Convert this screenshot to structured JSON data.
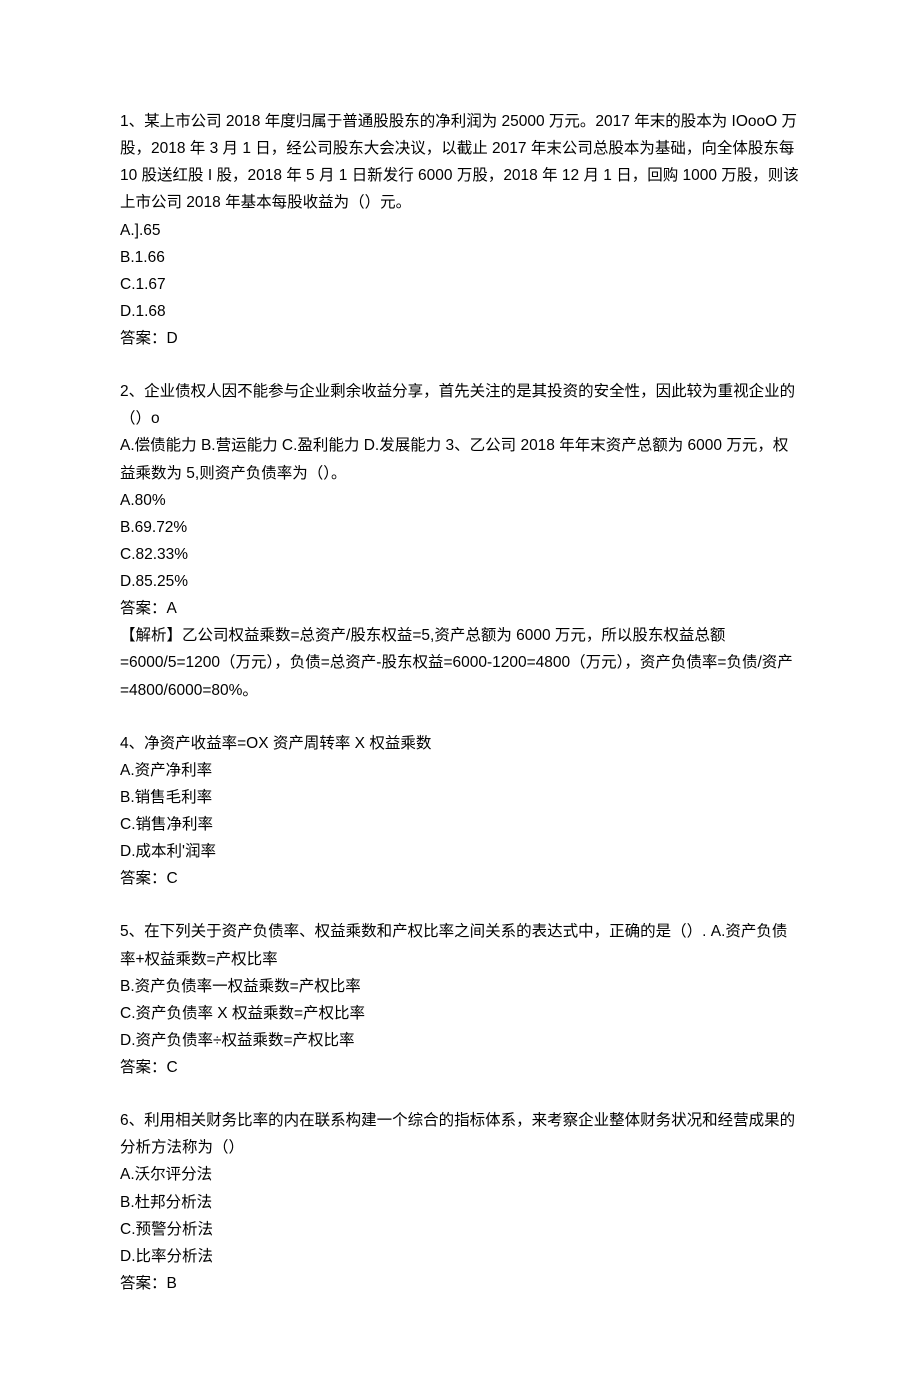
{
  "questions": [
    {
      "stem": [
        "1、某上市公司 2018 年度归属于普通股股东的净利润为 25000 万元。2017 年末的股本为 IOooO 万股，2018 年 3 月 1 日，经公司股东大会决议，以截止 2017 年末公司总股本为基础，向全体股东每 10 股送红股 I 股，2018 年 5 月 1 日新发行 6000 万股，2018 年 12 月 1 日，回购 1000 万股，则该上市公司 2018 年基本每股收益为（）元。"
      ],
      "options": [
        "A.].65",
        "B.1.66",
        "C.1.67",
        "D.1.68"
      ],
      "answer": "答案：D",
      "analysis": []
    },
    {
      "stem": [
        "2、企业债权人因不能参与企业剩余收益分享，首先关注的是其投资的安全性，因此较为重视企业的（）o",
        "A.偿债能力 B.营运能力 C.盈利能力 D.发展能力 3、乙公司 2018 年年末资产总额为 6000 万元，权益乘数为 5,则资产负债率为（）。"
      ],
      "options": [
        "A.80%",
        "B.69.72%",
        "C.82.33%",
        "D.85.25%"
      ],
      "answer": "答案：A",
      "analysis": [
        "【解析】乙公司权益乘数=总资产/股东权益=5,资产总额为 6000 万元，所以股东权益总额=6000/5=1200（万元），负债=总资产-股东权益=6000-1200=4800（万元），资产负债率=负债/资产=4800/6000=80%。"
      ]
    },
    {
      "stem": [
        "4、净资产收益率=OX 资产周转率 X 权益乘数"
      ],
      "options": [
        "A.资产净利率",
        "B.销售毛利率",
        "C.销售净利率",
        "D.成本利'润率"
      ],
      "answer": "答案：C",
      "analysis": []
    },
    {
      "stem": [
        "5、在下列关于资产负债率、权益乘数和产权比率之间关系的表达式中，正确的是（）. A.资产负债率+权益乘数=产权比率"
      ],
      "options": [
        "B.资产负债率一权益乘数=产权比率",
        "C.资产负债率 X 权益乘数=产权比率",
        "D.资产负债率÷权益乘数=产权比率"
      ],
      "answer": "答案：C",
      "analysis": []
    },
    {
      "stem": [
        "6、利用相关财务比率的内在联系构建一个综合的指标体系，来考察企业整体财务状况和经营成果的分析方法称为（）"
      ],
      "options": [
        "A.沃尔评分法",
        "B.杜邦分析法",
        "C.预警分析法",
        "D.比率分析法"
      ],
      "answer": "答案：B",
      "analysis": []
    }
  ]
}
